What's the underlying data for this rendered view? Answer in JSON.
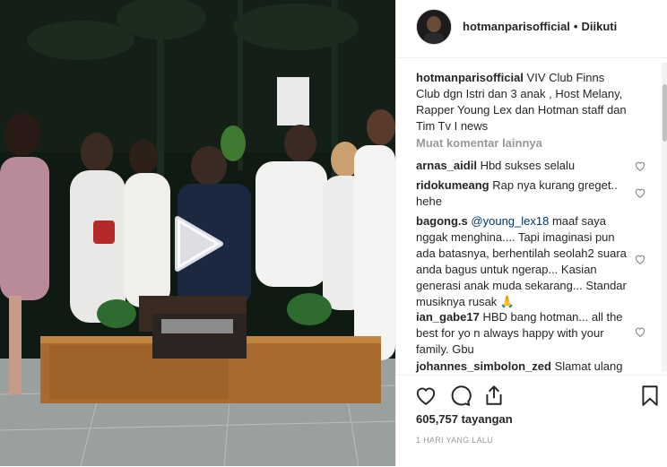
{
  "video": {
    "play_icon": "play-icon"
  },
  "header": {
    "username": "hotmanparisofficial",
    "separator": "•",
    "follow_status": "Diikuti"
  },
  "caption": {
    "username": "hotmanparisofficial",
    "text": "VIV Club Finns Club dgn Istri dan 3 anak , Host Melany, Rapper Young Lex dan Hotman staff dan Tim Tv I news"
  },
  "load_more": "Muat komentar lainnya",
  "comments": [
    {
      "username": "arnas_aidil",
      "text": "Hbd sukses selalu"
    },
    {
      "username": "ridokumeang",
      "text": "Rap nya kurang greget.. hehe"
    },
    {
      "username": "bagong.s",
      "mention": "@young_lex18",
      "text": "maaf saya nggak menghina.... Tapi imaginasi pun ada batasnya, berhentilah seolah2 suara anda bagus untuk ngerap... Kasian generasi anak muda sekarang... Standar musiknya rusak 🙏"
    },
    {
      "username": "ian_gabe17",
      "text": "HBD bang hotman... all the best for yo n always happy with your family. Gbu"
    },
    {
      "username": "johannes_simbolon_zed",
      "text": "Slamat ulang"
    }
  ],
  "actions": {
    "views": "605,757 tayangan",
    "timestamp": "1 HARI YANG LALU"
  },
  "colors": {
    "accent_link": "#003569",
    "muted": "#999999"
  }
}
